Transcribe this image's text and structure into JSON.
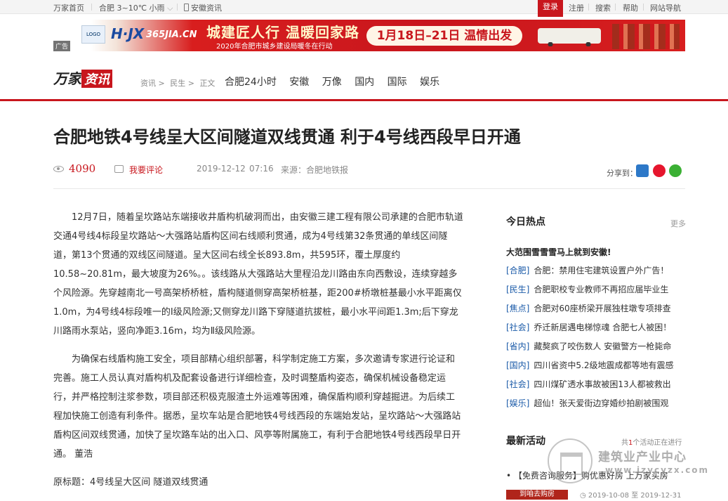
{
  "topbar": {
    "site_home": "万家首页",
    "weather": "合肥 3~10℃ 小雨",
    "app": "安徽资讯",
    "login": "登录",
    "register": "注册",
    "search": "搜索",
    "help": "帮助",
    "site_nav": "网站导航"
  },
  "banner": {
    "ad_tag": "广告",
    "brand1": "H·JX",
    "brand2": "365JIA.CN",
    "slogan": "城建匠人行 温暖回家路",
    "sub": "2020年合肥市城乡建设局暖冬在行动",
    "dates": "1月18日–21日 温情出发"
  },
  "header": {
    "brand_a": "万家",
    "brand_b": "资讯",
    "crumbs": [
      "资讯 >",
      "民生 >",
      "正文"
    ],
    "nav": [
      "合肥24小时",
      "安徽",
      "万像",
      "国内",
      "国际",
      "娱乐"
    ]
  },
  "article": {
    "title": "合肥地铁4号线呈大区间隧道双线贯通 利于4号线西段早日开通",
    "views": "4090",
    "comment": "我要评论",
    "date": "2019-12-12",
    "time": "07:16",
    "source": "来源：合肥地铁报",
    "share": "分享到：",
    "p1": "12月7日，随着呈坎路站东端接收井盾构机破洞而出，由安徽三建工程有限公司承建的合肥市轨道交通4号线4标段呈坎路站～大强路站盾构区间右线顺利贯通，成为4号线第32条贯通的单线区间隧道，第13个贯通的双线区间隧道。呈大区间右线全长893.8m，共595环，覆土厚度约10.58~20.81m，最大坡度为26%。。该线路从大强路站大里程沿龙川路由东向西敷设，连续穿越多个风险源。先穿越南北一号高架桥桥桩，盾构隧道侧穿高架桥桩基，距200#桥墩桩基最小水平距离仅1.0m，为4号线4标段唯一的Ⅰ级风险源;又侧穿龙川路下穿隧道抗拔桩，最小水平间距1.3m;后下穿龙川路雨水泵站，竖向净距3.16m，均为Ⅱ级风险源。",
    "p2": "为确保右线盾构施工安全，项目部精心组织部署，科学制定施工方案，多次邀请专家进行论证和完善。施工人员认真对盾构机及配套设备进行详细检查，及时调整盾构姿态，确保机械设备稳定运行，并严格控制注浆参数，项目部还积极克服渣土外运难等困难，确保盾构顺利穿越掘进。为后续工程加快施工创造有利条件。据悉，呈坎车站是合肥地铁4号线西段的东端始发站，呈坎路站～大强路站盾构区间双线贯通，加快了呈坎路车站的出入口、风亭等附属施工，有利于合肥地铁4号线西段早日开通。 董浩",
    "orig": "原标题：4号线呈大区间 隧道双线贯通"
  },
  "sidebar": {
    "hot_title": "今日热点",
    "more": "更多",
    "top_story": "大范围雪雪雪马上就到安徽!",
    "hot": [
      {
        "cat": "[合肥]",
        "text": "合肥：禁用住宅建筑设置户外广告！"
      },
      {
        "cat": "[民生]",
        "text": "合肥职校专业教师不再招应届毕业生"
      },
      {
        "cat": "[焦点]",
        "text": "合肥对60座桥梁开展独柱墩专项排查"
      },
      {
        "cat": "[社会]",
        "text": "乔迁新居遇电梯惊魂 合肥七人被困！"
      },
      {
        "cat": "[省内]",
        "text": "藏獒疯了咬伤数人 安徽警方一枪毙命"
      },
      {
        "cat": "[国内]",
        "text": "四川省资中5.2级地震成都等地有震感"
      },
      {
        "cat": "[社会]",
        "text": "四川煤矿透水事故被困13人都被救出"
      },
      {
        "cat": "[娱乐]",
        "text": "超仙！张天爱街边穿婚纱拍剧被围观"
      }
    ],
    "act_title": "最新活动",
    "act_note_a": "共",
    "act_note_num": "1",
    "act_note_b": "个活动正在进行",
    "act_item": "【免费咨询服务】购优惠好房 上万家买房",
    "act_img": "到咱去购房",
    "act_date": "2019-10-08 至 2019-12-31"
  },
  "watermark": {
    "line1": "建筑业产业中心",
    "line2": "www.jzycyzx.com"
  },
  "colors": {
    "brand_red": "#c8161d",
    "link_blue": "#1a5aa8"
  }
}
